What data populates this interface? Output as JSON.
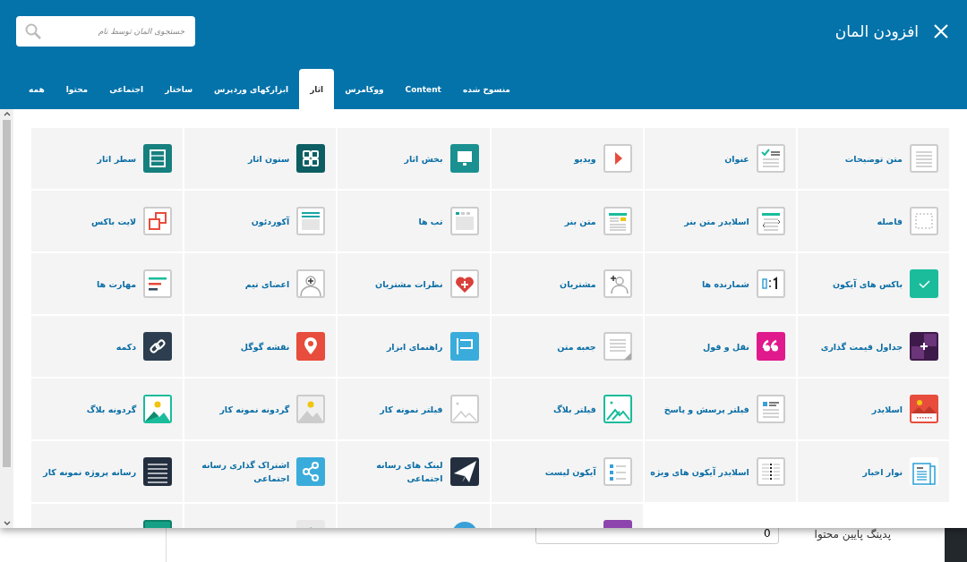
{
  "modal": {
    "title": "افزودن المان",
    "search": {
      "placeholder": "جستجوی المان توسط نام"
    },
    "tabs": [
      {
        "label": "منسوخ شده",
        "selected": false
      },
      {
        "label": "Content",
        "selected": false
      },
      {
        "label": "ووکامرس",
        "selected": false
      },
      {
        "label": "اثار",
        "selected": true
      },
      {
        "label": "ابزارکهای وردپرس",
        "selected": false
      },
      {
        "label": "ساختار",
        "selected": false
      },
      {
        "label": "اجتماعی",
        "selected": false
      },
      {
        "label": "محتوا",
        "selected": false
      },
      {
        "label": "همه",
        "selected": false
      }
    ],
    "elements": [
      {
        "kind": "item",
        "label": "متن توضیحات"
      },
      {
        "kind": "item",
        "label": "عنوان"
      },
      {
        "kind": "item",
        "label": "ویدیو"
      },
      {
        "kind": "item",
        "label": "بخش اثار"
      },
      {
        "kind": "item",
        "label": "ستون اثار"
      },
      {
        "kind": "item",
        "label": "سطر اثار"
      },
      {
        "kind": "item",
        "label": "فاصله"
      },
      {
        "kind": "item",
        "label": "اسلایدر متن بنر"
      },
      {
        "kind": "item",
        "label": "متن بنر"
      },
      {
        "kind": "item",
        "label": "تب ها"
      },
      {
        "kind": "item",
        "label": "آکوردئون"
      },
      {
        "kind": "item",
        "label": "لایت باکس"
      },
      {
        "kind": "item",
        "label": "باکس های آیکون"
      },
      {
        "kind": "item",
        "label": "شمارنده ها"
      },
      {
        "kind": "item",
        "label": "مشتریان"
      },
      {
        "kind": "item",
        "label": "نظرات مشتریان"
      },
      {
        "kind": "item",
        "label": "اعضای تیم"
      },
      {
        "kind": "item",
        "label": "مهارت ها"
      },
      {
        "kind": "item",
        "label": "جداول قیمت گذاری"
      },
      {
        "kind": "item",
        "label": "نقل و قول"
      },
      {
        "kind": "item",
        "label": "جعبه متن"
      },
      {
        "kind": "item",
        "label": "راهنمای ابزار"
      },
      {
        "kind": "item",
        "label": "نقشه گوگل"
      },
      {
        "kind": "item",
        "label": "دکمه"
      },
      {
        "kind": "item",
        "label": "اسلایدر"
      },
      {
        "kind": "item",
        "label": "فیلتر پرسش و پاسخ"
      },
      {
        "kind": "item",
        "label": "فیلتر بلاگ"
      },
      {
        "kind": "item",
        "label": "فیلتر نمونه کار"
      },
      {
        "kind": "item",
        "label": "گردونه نمونه کار"
      },
      {
        "kind": "item",
        "label": "گردونه بلاگ"
      },
      {
        "kind": "item",
        "label": "نوار اخبار"
      },
      {
        "kind": "item",
        "label": "اسلایدر آیکون های ویژه"
      },
      {
        "kind": "item",
        "label": "آیکون لیست"
      },
      {
        "kind": "item",
        "label": "لینک های رسانه اجتماعی"
      },
      {
        "kind": "item",
        "label": "اشتراک گذاری رسانه اجتماعی"
      },
      {
        "kind": "item",
        "label": "رسانه پروژه نمونه کار"
      },
      {
        "kind": "empty"
      },
      {
        "kind": "empty"
      },
      {
        "kind": "item"
      },
      {
        "kind": "item"
      },
      {
        "kind": "item"
      },
      {
        "kind": "item"
      }
    ]
  },
  "background": {
    "field_value": "0",
    "field_label": "پدینگ پایین محتوا"
  }
}
